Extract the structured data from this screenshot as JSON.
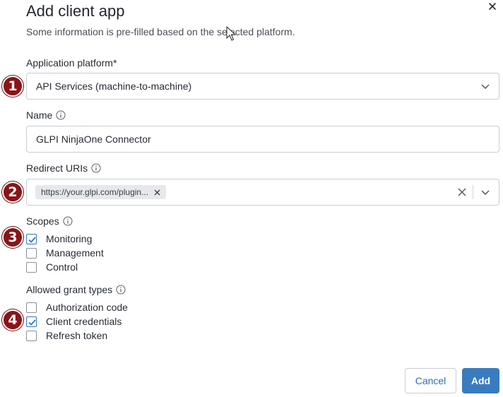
{
  "dialog": {
    "title": "Add client app",
    "subtitle": "Some information is pre-filled based on the selected platform."
  },
  "platform": {
    "label": "Application platform*",
    "value": "API Services (machine-to-machine)"
  },
  "name": {
    "label": "Name",
    "value": "GLPI NinjaOne Connector"
  },
  "redirect": {
    "label": "Redirect URIs",
    "tag": "https://your.glpi.com/plugin..."
  },
  "scopes": {
    "label": "Scopes",
    "items": [
      {
        "label": "Monitoring",
        "checked": true
      },
      {
        "label": "Management",
        "checked": false
      },
      {
        "label": "Control",
        "checked": false
      }
    ]
  },
  "grants": {
    "label": "Allowed grant types",
    "items": [
      {
        "label": "Authorization code",
        "checked": false
      },
      {
        "label": "Client credentials",
        "checked": true
      },
      {
        "label": "Refresh token",
        "checked": false
      }
    ]
  },
  "badges": [
    "1",
    "2",
    "3",
    "4"
  ],
  "buttons": {
    "cancel": "Cancel",
    "add": "Add"
  },
  "colors": {
    "accent": "#3a7bbf",
    "badge": "#8a1418"
  }
}
